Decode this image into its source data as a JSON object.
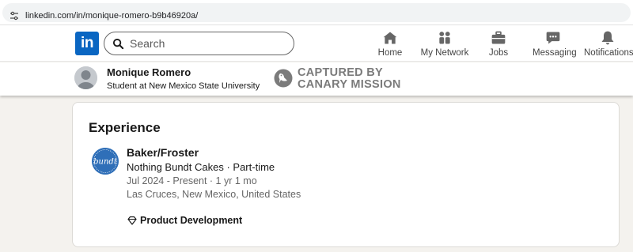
{
  "browser": {
    "url": "linkedin.com/in/monique-romero-b9b46920a/",
    "site_info_icon": "tune-icon"
  },
  "nav": {
    "logo_text": "in",
    "search": {
      "placeholder": "Search",
      "value": ""
    },
    "items": [
      {
        "label": "Home",
        "icon": "home-icon"
      },
      {
        "label": "My Network",
        "icon": "people-icon"
      },
      {
        "label": "Jobs",
        "icon": "briefcase-icon"
      },
      {
        "label": "Messaging",
        "icon": "chat-icon"
      },
      {
        "label": "Notifications",
        "icon": "bell-icon"
      }
    ]
  },
  "profile": {
    "name": "Monique Romero",
    "headline": "Student at New Mexico State University"
  },
  "watermark": {
    "line1": "CAPTURED BY",
    "line2": "CANARY MISSION"
  },
  "experience": {
    "section_title": "Experience",
    "entries": [
      {
        "title": "Baker/Froster",
        "company_line": "Nothing Bundt Cakes · Part-time",
        "dates": "Jul 2024 - Present · 1 yr 1 mo",
        "location": "Las Cruces, New Mexico, United States",
        "logo_text": "bundt",
        "skills": "Product Development"
      }
    ]
  },
  "colors": {
    "linkedin_blue": "#0a66c2",
    "page_bg": "#f4f2ee",
    "bundt_logo": "#2f6fb8",
    "watermark_gray": "#7b7b7b"
  }
}
